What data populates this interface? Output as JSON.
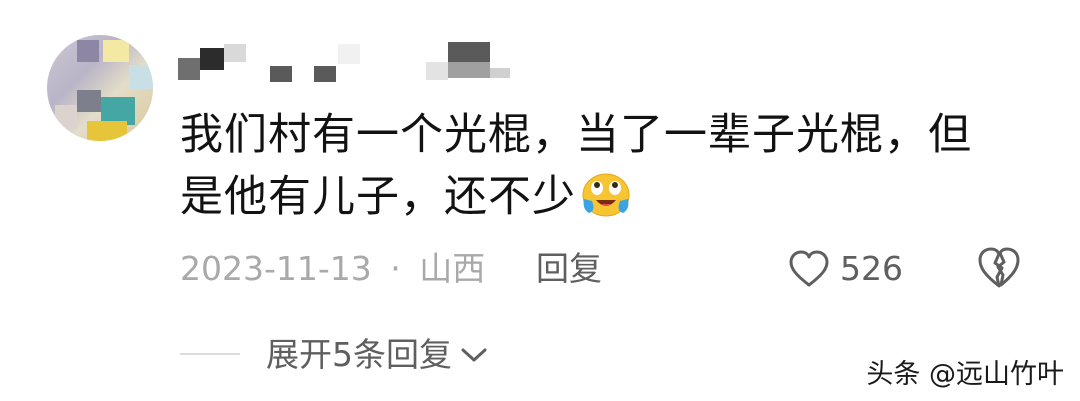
{
  "comment": {
    "text_line1": "我们村有一个光棍，当了一辈子光棍，但",
    "text_line2": "是他有儿子，还不少",
    "emoji": "crying-laughing-emoji",
    "date": "2023-11-13",
    "separator": "·",
    "location": "山西",
    "reply_label": "回复",
    "like_count": "526",
    "like_icon": "heart-outline-icon",
    "dislike_icon": "broken-heart-icon"
  },
  "replies": {
    "expand_label": "展开5条回复",
    "chevron_icon": "chevron-down-icon"
  },
  "watermark": "头条 @远山竹叶",
  "colors": {
    "text": "#121212",
    "meta": "#a9a9a9",
    "action": "#5f5f5f",
    "emoji_face": "#f7c531",
    "emoji_tear": "#3aa3e8"
  }
}
